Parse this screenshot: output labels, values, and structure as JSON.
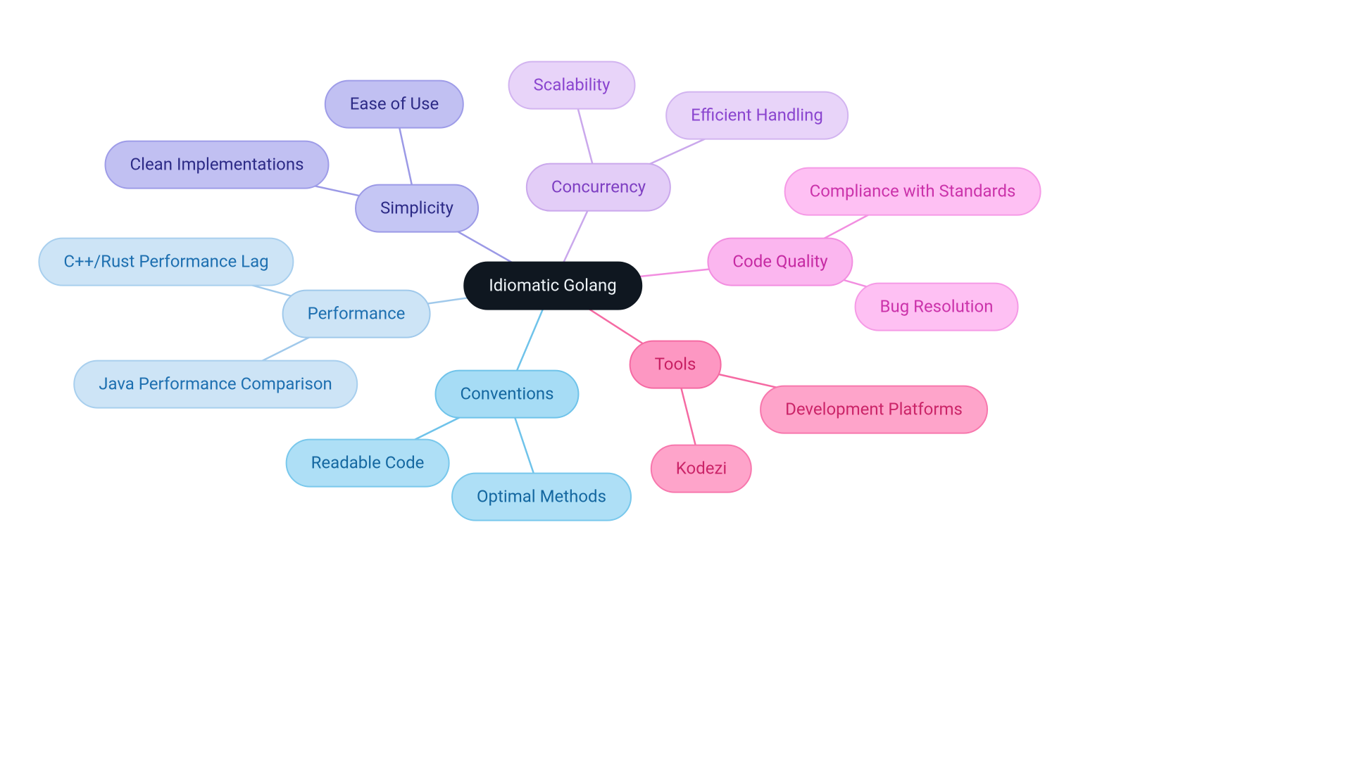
{
  "center": {
    "label": "Idiomatic Golang"
  },
  "branches": {
    "simplicity": {
      "label": "Simplicity",
      "children": {
        "ease": "Ease of Use",
        "clean": "Clean Implementations"
      }
    },
    "concurrency": {
      "label": "Concurrency",
      "children": {
        "scalability": "Scalability",
        "efficient": "Efficient Handling"
      }
    },
    "codequality": {
      "label": "Code Quality",
      "children": {
        "compliance": "Compliance with Standards",
        "bug": "Bug Resolution"
      }
    },
    "tools": {
      "label": "Tools",
      "children": {
        "kodezi": "Kodezi",
        "devplatforms": "Development Platforms"
      }
    },
    "conventions": {
      "label": "Conventions",
      "children": {
        "readable": "Readable Code",
        "optimal": "Optimal Methods"
      }
    },
    "performance": {
      "label": "Performance",
      "children": {
        "cpprust": "C++/Rust Performance Lag",
        "java": "Java Performance Comparison"
      }
    }
  },
  "colors": {
    "center": "#0f1720",
    "simplicity": "#9b99e6",
    "concurrency": "#caa8ec",
    "codequality": "#f28ee0",
    "tools": "#f56aa3",
    "conventions": "#6fc3ea",
    "performance": "#a0c9eb"
  }
}
